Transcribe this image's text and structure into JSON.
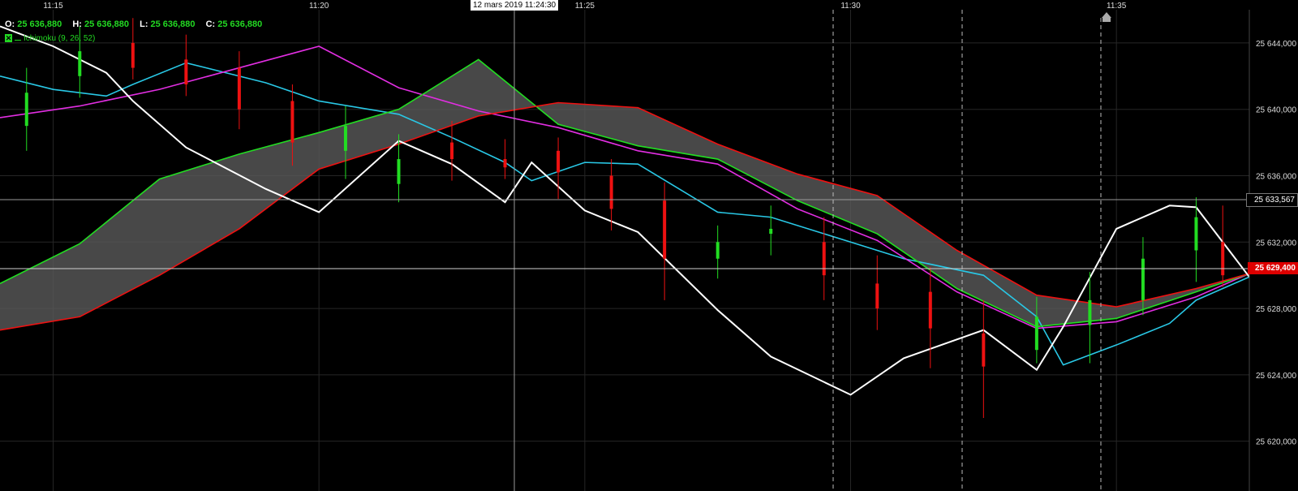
{
  "header": {
    "open_label": "O:",
    "open_value": "25 636,880",
    "high_label": "H:",
    "high_value": "25 636,880",
    "low_label": "L:",
    "low_value": "25 636,880",
    "close_label": "C:",
    "close_value": "25 636,880",
    "indicator_label": "Ichimoku (9, 26, 52)"
  },
  "crosshair": {
    "time_label": "12 mars 2019 11:24:30",
    "price_label": "25 633,567"
  },
  "last_price_label": "25 629,400",
  "colors": {
    "background": "#000000",
    "grid": "#262626",
    "up_candle": "#22dd22",
    "down_candle": "#ee1111",
    "doji": "#ffffff",
    "tenkan": "#29c8e6",
    "kijun": "#e22ee2",
    "chikou": "#ffffff",
    "span_a": "#22dd22",
    "span_b": "#ee1111",
    "cloud_fill": "#5a5a5a"
  },
  "chart_data": {
    "type": "line",
    "x_tick_labels": [
      "11:15",
      "11:20",
      "11:25",
      "11:30",
      "11:35"
    ],
    "y_tick_labels": [
      "25 644,000",
      "25 640,000",
      "25 636,000",
      "25 632,000",
      "25 628,000",
      "25 624,000",
      "25 620,000"
    ],
    "ylim": [
      25617000,
      25646000
    ],
    "grid": true,
    "x_range_minutes": [
      11.23,
      11.7
    ],
    "last_price": 25629400,
    "crosshair_price": 25633567,
    "series": [
      {
        "key": "tenkan",
        "x": [
          11.23,
          11.25,
          11.27,
          11.28,
          11.3,
          11.33,
          11.35,
          11.38,
          11.4,
          11.42,
          11.43,
          11.45,
          11.47,
          11.5,
          11.52,
          11.55,
          11.57,
          11.6,
          11.62,
          11.63,
          11.65,
          11.67,
          11.68,
          11.7
        ],
        "values": [
          25642000,
          25641200,
          25640800,
          25641500,
          25642800,
          25641600,
          25640500,
          25639700,
          25638300,
          25636800,
          25635700,
          25636800,
          25636700,
          25633800,
          25633500,
          25632000,
          25631000,
          25630000,
          25627500,
          25624600,
          25625800,
          25627100,
          25628500,
          25629900
        ]
      },
      {
        "key": "kijun",
        "x": [
          11.23,
          11.26,
          11.29,
          11.32,
          11.35,
          11.38,
          11.41,
          11.44,
          11.47,
          11.5,
          11.53,
          11.56,
          11.59,
          11.62,
          11.65,
          11.68,
          11.7
        ],
        "values": [
          25639500,
          25640200,
          25641200,
          25642500,
          25643800,
          25641300,
          25639900,
          25638900,
          25637500,
          25636700,
          25634000,
          25632100,
          25629000,
          25626800,
          25627200,
          25628700,
          25630100
        ]
      },
      {
        "key": "span_a",
        "x": [
          11.23,
          11.26,
          11.29,
          11.32,
          11.35,
          11.38,
          11.41,
          11.44,
          11.47,
          11.5,
          11.53,
          11.56,
          11.59,
          11.62,
          11.65,
          11.68,
          11.7
        ],
        "values": [
          25629500,
          25631900,
          25635800,
          25637300,
          25638600,
          25640000,
          25643000,
          25639100,
          25637800,
          25637000,
          25634500,
          25632500,
          25629200,
          25626900,
          25627400,
          25629000,
          25630100
        ]
      },
      {
        "key": "span_b",
        "x": [
          11.23,
          11.26,
          11.29,
          11.32,
          11.35,
          11.38,
          11.41,
          11.44,
          11.47,
          11.5,
          11.53,
          11.56,
          11.59,
          11.62,
          11.65,
          11.68,
          11.7
        ],
        "values": [
          25626700,
          25627500,
          25630000,
          25632800,
          25636400,
          25637900,
          25639600,
          25640400,
          25640100,
          25637900,
          25636100,
          25634800,
          25631500,
          25628800,
          25628100,
          25629200,
          25630100
        ]
      },
      {
        "key": "chikou",
        "x": [
          11.23,
          11.25,
          11.27,
          11.28,
          11.3,
          11.33,
          11.35,
          11.38,
          11.4,
          11.42,
          11.43,
          11.45,
          11.47,
          11.5,
          11.52,
          11.55,
          11.57,
          11.6,
          11.62,
          11.63,
          11.65,
          11.67,
          11.68,
          11.7
        ],
        "values": [
          25645000,
          25643800,
          25642200,
          25640500,
          25637700,
          25635200,
          25633800,
          25638100,
          25636700,
          25634400,
          25636800,
          25633900,
          25632600,
          25627900,
          25625100,
          25622800,
          25625000,
          25626700,
          25624300,
          25626900,
          25632800,
          25634200,
          25634100,
          25629900
        ]
      }
    ],
    "candles": {
      "x": [
        11.24,
        11.26,
        11.28,
        11.3,
        11.32,
        11.34,
        11.36,
        11.38,
        11.4,
        11.42,
        11.44,
        11.46,
        11.48,
        11.5,
        11.52,
        11.54,
        11.56,
        11.58,
        11.6,
        11.62,
        11.64,
        11.66,
        11.68,
        11.69
      ],
      "open": [
        25639000,
        25642000,
        25644000,
        25643000,
        25642500,
        25640500,
        25637500,
        25635500,
        25638000,
        25637000,
        25637500,
        25636000,
        25634500,
        25631000,
        25632500,
        25632000,
        25629500,
        25629000,
        25626500,
        25625500,
        25627000,
        25628500,
        25631500,
        25632000
      ],
      "close": [
        25641000,
        25643500,
        25642500,
        25641500,
        25640000,
        25638000,
        25639000,
        25637000,
        25637000,
        25636500,
        25636200,
        25634000,
        25631000,
        25632000,
        25632800,
        25630000,
        25628000,
        25626800,
        25624500,
        25627500,
        25628500,
        25631000,
        25633500,
        25630000
      ],
      "high": [
        25642500,
        25645000,
        25645500,
        25644500,
        25643500,
        25641500,
        25640200,
        25638500,
        25639300,
        25638200,
        25638300,
        25637000,
        25635600,
        25633000,
        25634200,
        25633500,
        25631200,
        25630500,
        25628500,
        25628700,
        25630200,
        25632300,
        25634700,
        25634200
      ],
      "low": [
        25637500,
        25640700,
        25641800,
        25640800,
        25638800,
        25636600,
        25635800,
        25634400,
        25635700,
        25635800,
        25634600,
        25632700,
        25628500,
        25629800,
        25631200,
        25628500,
        25626700,
        25624400,
        25621400,
        25624700,
        25624700,
        25627600,
        25629600,
        25629300
      ]
    }
  }
}
